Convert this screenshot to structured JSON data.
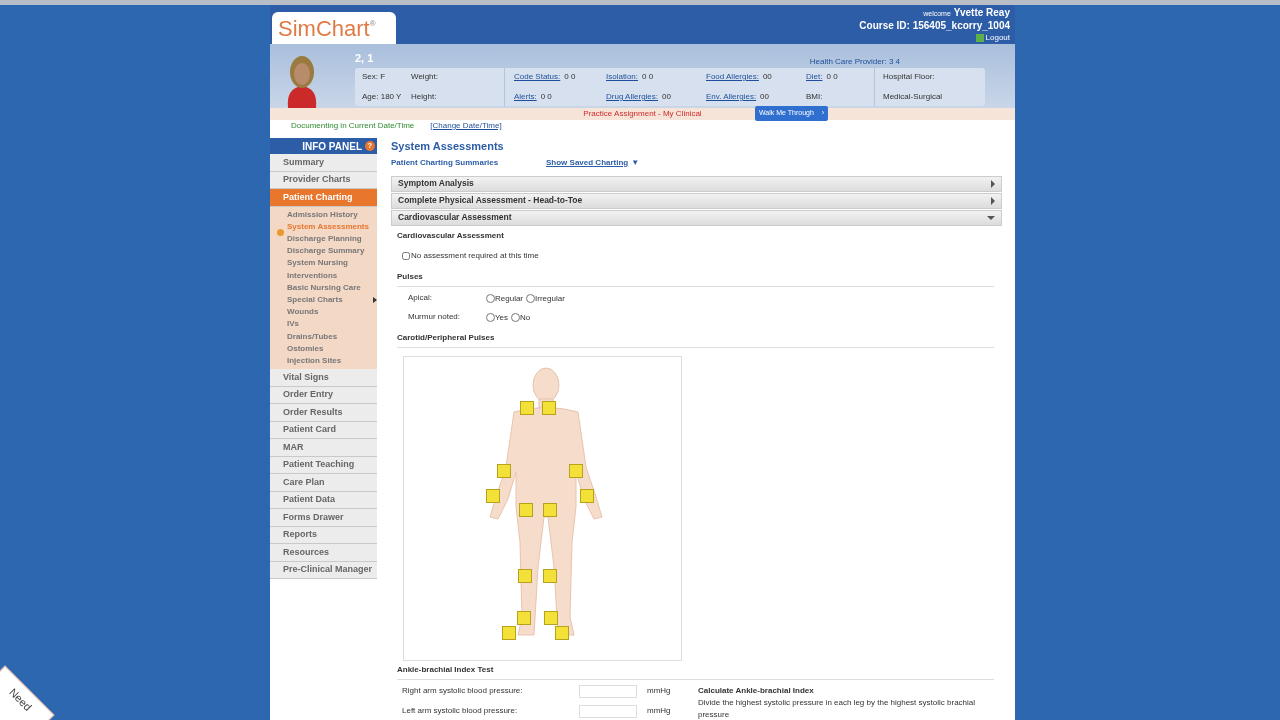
{
  "header": {
    "logo": "SimChart",
    "logo_mark": "®",
    "welcome": "welcome",
    "user": "Yvette Reay",
    "course": "Course ID: 156405_kcorry_1004",
    "logout": "Logout"
  },
  "patient": {
    "name": "2, 1",
    "provider": "Health Care Provider: 3 4",
    "basic": [
      {
        "label": "Sex: F"
      },
      {
        "label": "Weight:"
      },
      {
        "label": "Age: 180  Y"
      },
      {
        "label": "Height:"
      }
    ],
    "links": [
      {
        "label": "Code Status:",
        "value": "0 0",
        "link": true
      },
      {
        "label": "Isolation:",
        "value": "0 0",
        "link": true
      },
      {
        "label": "Food Allergies:",
        "value": "00",
        "link": true
      },
      {
        "label": "Diet:",
        "value": "0 0",
        "link": true
      },
      {
        "label": "Alerts:",
        "value": "0 0",
        "link": true
      },
      {
        "label": "Drug Allergies:",
        "value": "00",
        "link": true
      },
      {
        "label": "Env. Allergies:",
        "value": "00",
        "link": true
      },
      {
        "label": "BMI:",
        "link": false
      }
    ],
    "floor_label": "Hospital Floor:",
    "floor": "Medical-Surgical"
  },
  "assignment": {
    "text": "Practice Assignment - My Clinical",
    "walk_button": "Walk Me Through",
    "walk_arrow": "›"
  },
  "documenting": {
    "text": "Documenting in Current Date/Time",
    "change_link": "[Change Date/Time]"
  },
  "nav": {
    "title": "INFO PANEL",
    "help": "?",
    "items": [
      {
        "label": "Summary",
        "selected": false
      },
      {
        "label": "Provider Charts",
        "selected": false
      },
      {
        "label": "Patient Charting",
        "selected": true,
        "children": [
          {
            "label": "Admission History",
            "selected": false,
            "has_submenu": false
          },
          {
            "label": "System Assessments",
            "selected": true,
            "has_submenu": false
          },
          {
            "label": "Discharge Planning",
            "selected": false,
            "has_submenu": false
          },
          {
            "label": "Discharge Summary",
            "selected": false,
            "has_submenu": false
          },
          {
            "label": "System Nursing Interventions",
            "selected": false,
            "has_submenu": false
          },
          {
            "label": "Basic Nursing Care",
            "selected": false,
            "has_submenu": false
          },
          {
            "label": "Special Charts",
            "selected": false,
            "has_submenu": true
          },
          {
            "label": "Wounds",
            "selected": false,
            "has_submenu": false
          },
          {
            "label": "IVs",
            "selected": false,
            "has_submenu": false
          },
          {
            "label": "Drains/Tubes",
            "selected": false,
            "has_submenu": false
          },
          {
            "label": "Ostomies",
            "selected": false,
            "has_submenu": false
          },
          {
            "label": "Injection Sites",
            "selected": false,
            "has_submenu": false
          }
        ]
      },
      {
        "label": "Vital Signs",
        "selected": false
      },
      {
        "label": "Order Entry",
        "selected": false
      },
      {
        "label": "Order Results",
        "selected": false
      },
      {
        "label": "Patient Card",
        "selected": false
      },
      {
        "label": "MAR",
        "selected": false
      },
      {
        "label": "Patient Teaching",
        "selected": false
      },
      {
        "label": "Care Plan",
        "selected": false
      },
      {
        "label": "Patient Data",
        "selected": false
      },
      {
        "label": "Forms Drawer",
        "selected": false
      },
      {
        "label": "Reports",
        "selected": false
      },
      {
        "label": "Resources",
        "selected": false
      },
      {
        "label": "Pre-Clinical Manager",
        "selected": false
      }
    ]
  },
  "main": {
    "title": "System Assessments",
    "summaries_link": "Patient Charting Summaries",
    "saved_link": "Show Saved Charting",
    "saved_caret": "▼",
    "sections": [
      {
        "title": "Symptom Analysis",
        "expanded": false
      },
      {
        "title": "Complete Physical Assessment - Head-to-Toe",
        "expanded": false
      },
      {
        "title": "Cardiovascular Assessment",
        "expanded": true
      }
    ],
    "cardio": {
      "heading": "Cardiovascular Assessment",
      "no_assessment": {
        "label": "No assessment required at this time",
        "checked": false
      },
      "pulses_heading": "Pulses",
      "pulse_rows": [
        {
          "label": "Apical:",
          "options": [
            {
              "label": "Regular",
              "selected": false
            },
            {
              "label": "Irregular",
              "selected": false
            }
          ]
        },
        {
          "label": "Murmur noted:",
          "options": [
            {
              "label": "Yes",
              "selected": false
            },
            {
              "label": "No",
              "selected": false
            }
          ]
        }
      ],
      "peripheral_heading": "Carotid/Peripheral Pulses",
      "abi_heading": "Ankle-brachial Index Test",
      "abi_fields": [
        {
          "label": "Right arm systolic blood pressure:",
          "unit": "mmHg"
        },
        {
          "label": "Left arm systolic blood pressure:",
          "unit": "mmHg"
        }
      ],
      "calc_title": "Calculate Ankle-brachial Index",
      "calc_text": "Divide the highest systolic pressure in each leg by the highest systolic brachial pressure"
    }
  },
  "corner_tab": "Need"
}
